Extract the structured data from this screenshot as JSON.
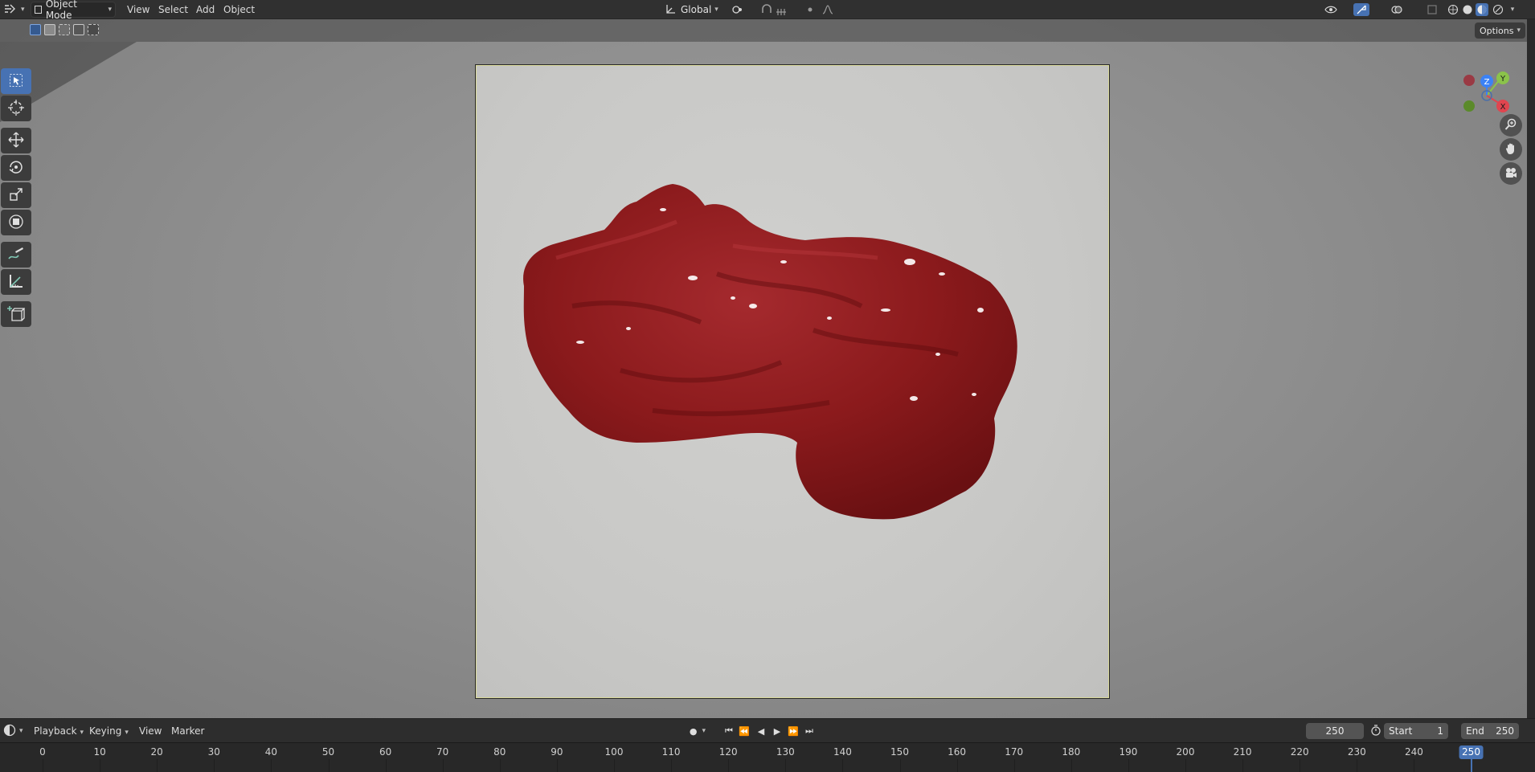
{
  "header": {
    "mode": "Object Mode",
    "menus": [
      "View",
      "Select",
      "Add",
      "Object"
    ],
    "transform_orientation": "Global"
  },
  "viewport": {
    "options_label": "Options",
    "gizmo": {
      "x": "X",
      "y": "Y",
      "z": "Z"
    },
    "object_color": "#8b1a1a"
  },
  "timeline": {
    "menus": [
      "Playback",
      "Keying",
      "View",
      "Marker"
    ],
    "current_frame": "250",
    "start_label": "Start",
    "start_value": "1",
    "end_label": "End",
    "end_value": "250",
    "ruler_ticks": [
      "0",
      "10",
      "20",
      "30",
      "40",
      "50",
      "60",
      "70",
      "80",
      "90",
      "100",
      "110",
      "120",
      "130",
      "140",
      "150",
      "160",
      "170",
      "180",
      "190",
      "200",
      "210",
      "220",
      "230",
      "240"
    ],
    "ruler_current": "250"
  },
  "colors": {
    "accent": "#4772b3",
    "x_axis": "#e0454f",
    "y_axis": "#8bc34a",
    "z_axis": "#3b82f6"
  }
}
